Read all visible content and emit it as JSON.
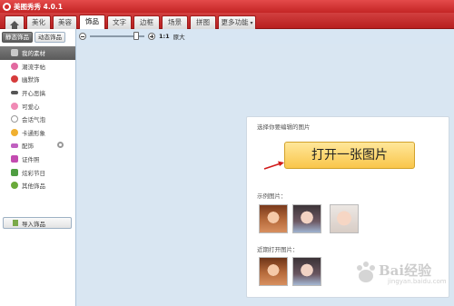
{
  "window": {
    "title": "美图秀秀 4.0.1"
  },
  "tabs": [
    {
      "label": "",
      "icon": "home-icon"
    },
    {
      "label": "美化"
    },
    {
      "label": "美容"
    },
    {
      "label": "饰品",
      "active": true
    },
    {
      "label": "文字"
    },
    {
      "label": "边框"
    },
    {
      "label": "场景"
    },
    {
      "label": "拼图"
    },
    {
      "label": "更多功能",
      "dropdown": true
    }
  ],
  "sidebar": {
    "subtabs": [
      {
        "label": "静态饰品",
        "active": true
      },
      {
        "label": "动态饰品"
      }
    ],
    "categories": [
      {
        "label": "我的素材",
        "selected": true,
        "icon": "folder-icon",
        "color": "#c9c9c9"
      },
      {
        "label": "潮流字帖",
        "icon": "heart-icon",
        "color": "#e26aa0"
      },
      {
        "label": "幽默饰",
        "icon": "face-icon",
        "color": "#d63c3c"
      },
      {
        "label": "开心恶搞",
        "icon": "mustache-icon",
        "color": "#555555"
      },
      {
        "label": "可爱心",
        "icon": "heart-icon",
        "color": "#f08ab5"
      },
      {
        "label": "会话气泡",
        "icon": "bubble-icon",
        "color": "#999999"
      },
      {
        "label": "卡通形象",
        "icon": "smiley-icon",
        "color": "#f0b030"
      },
      {
        "label": "配饰",
        "icon": "bow-icon",
        "color": "#c060c0",
        "settings": true
      },
      {
        "label": "证件照",
        "icon": "badge-icon",
        "color": "#c34bb0"
      },
      {
        "label": "炫彩节日",
        "icon": "gift-icon",
        "color": "#4f9e42"
      },
      {
        "label": "其他饰品",
        "icon": "clover-icon",
        "color": "#6aaa3a"
      }
    ],
    "import_label": "导入饰品"
  },
  "toolbar": {
    "zoom_ratio_label": "1:1",
    "fit_label": "原大",
    "zoom_level_fraction": 0.85
  },
  "panel": {
    "hint": "选择你要编辑的图片",
    "open_button": "打开一张图片",
    "sample_label": "示例图片：",
    "recent_label": "近期打开图片："
  },
  "watermark": {
    "text": "Bai经验",
    "sub": "jingyan.baidu.com"
  },
  "colors": {
    "brand_red": "#c42525",
    "button_yellow": "#f9c64b",
    "arrow_red": "#d11a1a"
  }
}
